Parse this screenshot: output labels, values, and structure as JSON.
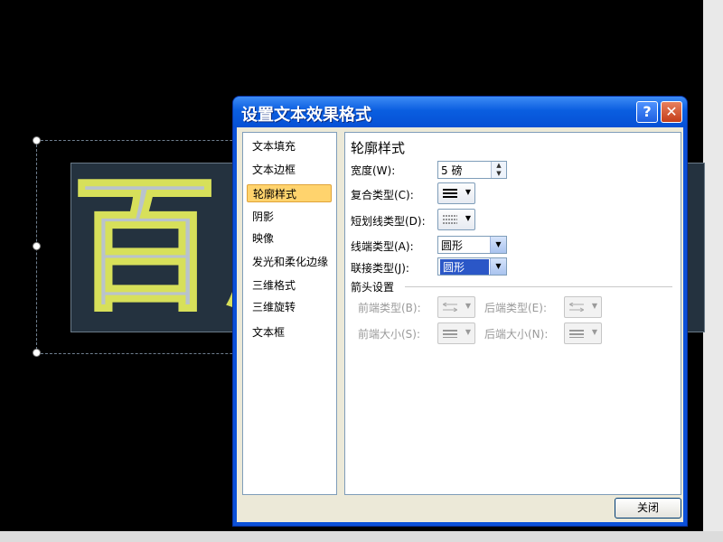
{
  "slide": {
    "text": "百度"
  },
  "dialog": {
    "title": "设置文本效果格式",
    "help_glyph": "?",
    "close_glyph": "✕",
    "nav": [
      {
        "label": "文本填充"
      },
      {
        "label": "文本边框"
      },
      {
        "label": "轮廓样式",
        "selected": true
      },
      {
        "label": "阴影"
      },
      {
        "label": "映像"
      },
      {
        "label": "发光和柔化边缘"
      },
      {
        "label": "三维格式"
      },
      {
        "label": "三维旋转"
      },
      {
        "label": "文本框"
      }
    ],
    "panel": {
      "heading": "轮廓样式",
      "width_label": "宽度(W):",
      "width_value": "5 磅",
      "compound_label": "复合类型(C):",
      "dash_label": "短划线类型(D):",
      "cap_label": "线端类型(A):",
      "cap_value": "圆形",
      "join_label": "联接类型(J):",
      "join_value": "圆形",
      "arrow_section": "箭头设置",
      "begin_type_label": "前端类型(B):",
      "end_type_label": "后端类型(E):",
      "begin_size_label": "前端大小(S):",
      "end_size_label": "后端大小(N):"
    },
    "close_button": "关闭"
  }
}
